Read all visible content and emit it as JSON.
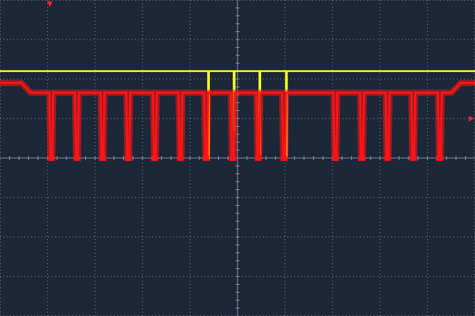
{
  "chart_data": {
    "type": "line",
    "title": "",
    "xlabel": "",
    "ylabel": "",
    "grid": true,
    "divisions": {
      "horizontal": 10,
      "vertical": 8
    },
    "xlim": [
      0,
      10
    ],
    "ylim": [
      -4,
      4
    ],
    "colors": {
      "background": "#1c2738",
      "grid": "#8c98ab",
      "ch1": "#ffff1a",
      "ch2": "#ff1414",
      "marker": "#ff2020"
    },
    "series": [
      {
        "channel": "CH1",
        "color": "#ffff1a",
        "x": [
          0,
          4.38,
          4.38,
          4.4,
          4.4,
          4.92,
          4.92,
          4.94,
          4.94,
          5.46,
          5.46,
          5.48,
          5.48,
          6.02,
          6.02,
          6.04,
          6.04,
          10
        ],
        "y": [
          2.2,
          2.2,
          0,
          0,
          2.2,
          2.2,
          0.7,
          0.7,
          2.2,
          2.2,
          0.1,
          0.1,
          2.2,
          2.2,
          0.05,
          0.05,
          2.2,
          2.2
        ]
      },
      {
        "channel": "CH2",
        "color": "#ff1414",
        "x": [
          0,
          0.45,
          0.65,
          1.04,
          1.06,
          1.1,
          1.12,
          1.58,
          1.6,
          1.64,
          1.66,
          2.12,
          2.14,
          2.18,
          2.2,
          2.66,
          2.68,
          2.72,
          2.74,
          3.22,
          3.24,
          3.28,
          3.3,
          3.76,
          3.78,
          3.82,
          3.84,
          4.3,
          4.32,
          4.36,
          4.38,
          4.86,
          4.88,
          4.92,
          4.94,
          5.4,
          5.42,
          5.46,
          5.48,
          5.94,
          5.96,
          6.0,
          6.02,
          7.02,
          7.04,
          7.08,
          7.1,
          7.58,
          7.6,
          7.64,
          7.66,
          8.12,
          8.14,
          8.18,
          8.2,
          8.66,
          8.68,
          8.72,
          8.74,
          9.22,
          9.24,
          9.28,
          9.3,
          9.5,
          9.7,
          10
        ],
        "y": [
          1.9,
          1.9,
          1.65,
          1.65,
          0,
          0,
          1.65,
          1.65,
          0,
          0,
          1.65,
          1.65,
          0,
          0,
          1.65,
          1.65,
          0,
          0,
          1.65,
          1.65,
          0,
          0,
          1.65,
          1.65,
          0,
          0,
          1.65,
          1.65,
          0,
          0,
          1.65,
          1.65,
          0,
          0,
          1.65,
          1.65,
          0,
          0,
          1.65,
          1.65,
          0,
          0,
          1.65,
          1.65,
          0,
          0,
          1.65,
          1.65,
          0,
          0,
          1.65,
          1.65,
          0,
          0,
          1.65,
          1.65,
          0,
          0,
          1.65,
          1.65,
          0,
          0,
          1.65,
          1.65,
          1.9,
          1.9
        ]
      }
    ]
  }
}
